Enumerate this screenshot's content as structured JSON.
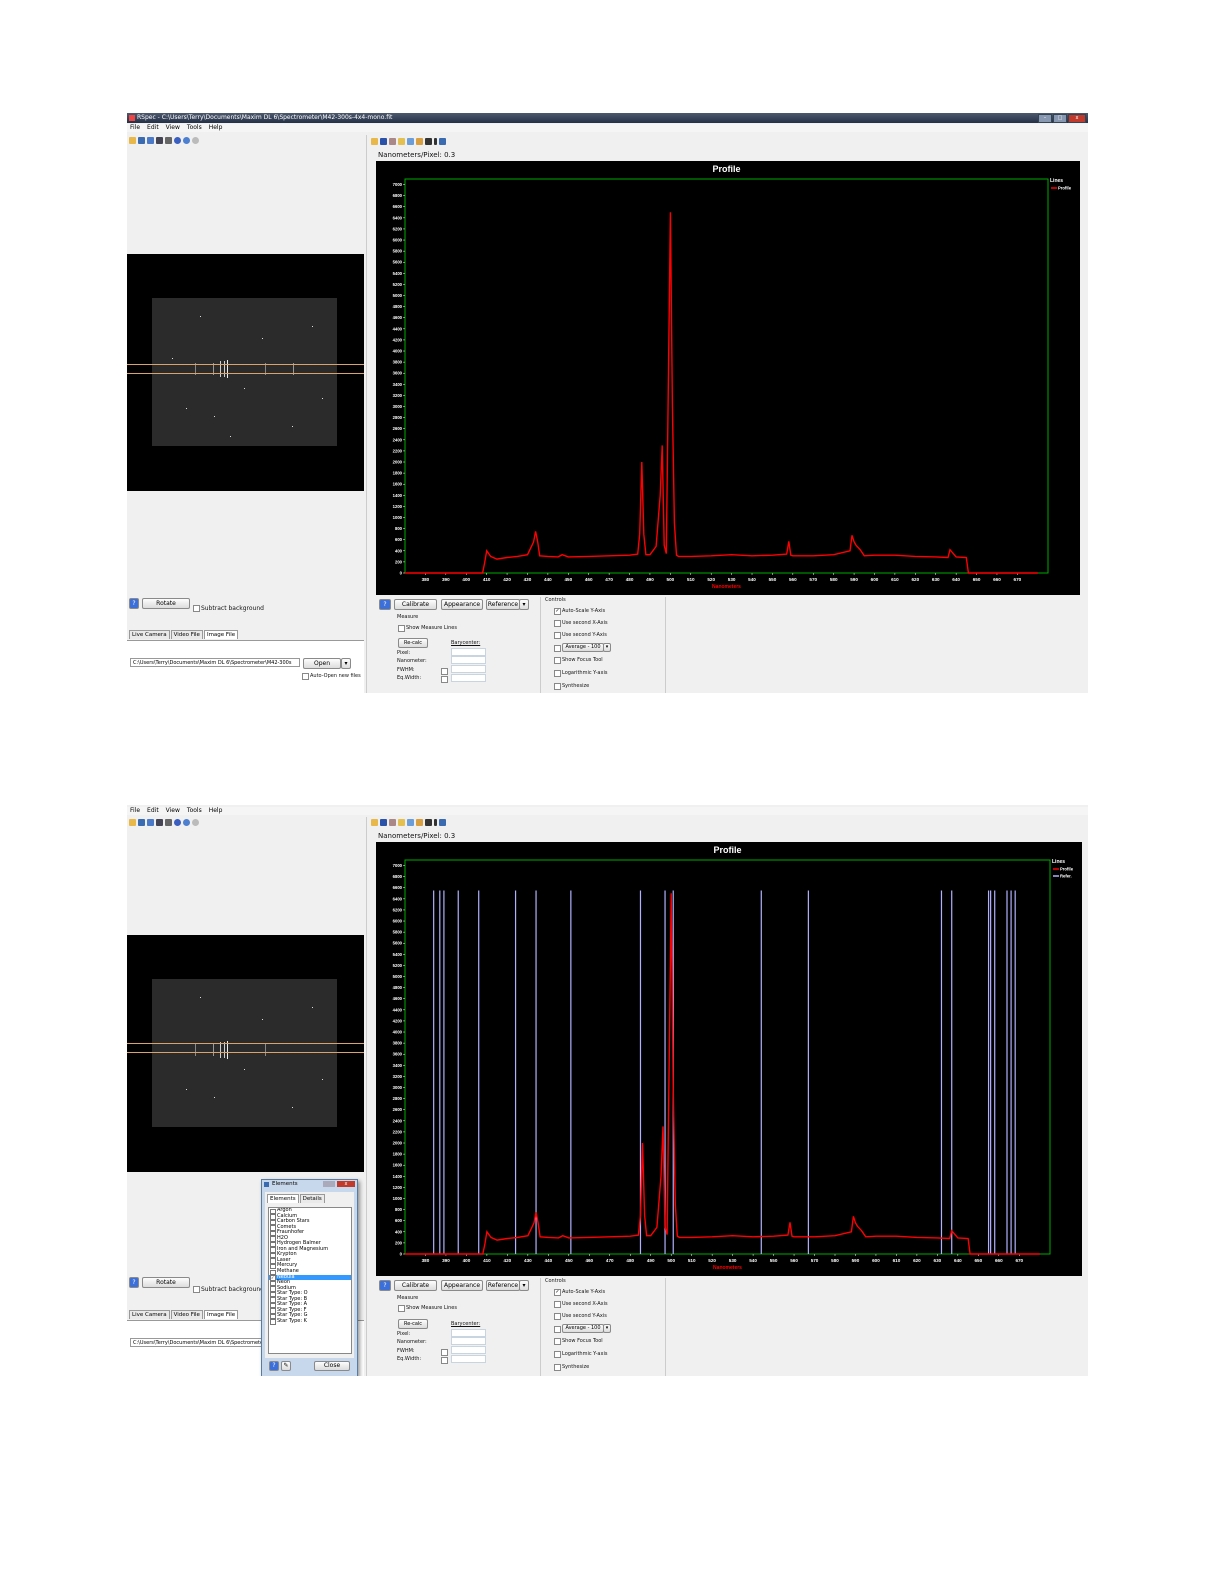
{
  "window": {
    "title": "RSpec - C:\\Users\\Terry\\Documents\\Maxim DL 6\\Spectrometer\\M42-300s-4x4-mono.fit",
    "menu": [
      "File",
      "Edit",
      "View",
      "Tools",
      "Help"
    ]
  },
  "left": {
    "rotate_label": "Rotate",
    "subtract_bg_label": "Subtract background",
    "tabs": [
      "Live Camera",
      "Video File",
      "Image File"
    ],
    "active_tab": "Image File",
    "file_path": "C:\\Users\\Terry\\Documents\\Maxim DL 6\\Spectrometer\\M42-300s",
    "file_path_2": "C:\\Users\\Terry\\Documents\\Maxim DL 6\\Spectromete",
    "open_label": "Open",
    "auto_open_label": "Auto-Open new files"
  },
  "right": {
    "nm_per_pixel": "Nanometers/Pixel: 0.3",
    "calibrate": "Calibrate",
    "appearance": "Appearance",
    "reference": "Reference",
    "measure_label": "Measure",
    "show_measure_lines": "Show Measure Lines",
    "recalc": "Re-calc",
    "barycenter": "Barycenter:",
    "pixel": "Pixel:",
    "nanometer": "Nanometer:",
    "fwhm": "FWHM:",
    "eqwidth": "Eq.Width:",
    "controls_label": "Controls",
    "controls": {
      "auto_scale": "Auto-Scale Y-Axis",
      "second_x": "Use second X-Axis",
      "second_y": "Use second Y-Axis",
      "average": "Average - 100",
      "focus": "Show Focus Tool",
      "log": "Logarithmic Y-axis",
      "synth": "Synthesize"
    }
  },
  "dialog": {
    "title": "Elements",
    "tabs": [
      "Elements",
      "Details"
    ],
    "items": [
      "Argon",
      "Calcium",
      "Carbon Stars",
      "Comets",
      "Fraunhofer",
      "H2O",
      "Hydrogen Balmer",
      "Iron and Magnesium",
      "Krypton",
      "Laser",
      "Mercury",
      "Methane",
      "Nebula",
      "Neon",
      "Sodium",
      "Star Type: O",
      "Star Type: B",
      "Star Type: A",
      "Star Type: F",
      "Star Type: G",
      "Star Type: K"
    ],
    "selected": "Nebula",
    "close_label": "Close"
  },
  "colors": {
    "profile": "#ff0000",
    "reference": "#b0b0ff",
    "frame": "#00aa00",
    "chart_bg": "#000000"
  },
  "chart_data": [
    {
      "type": "line",
      "title": "Profile",
      "xlabel": "Nanometers",
      "ylabel": "",
      "xlim": [
        370,
        685
      ],
      "ylim": [
        0,
        7100
      ],
      "x_ticks": [
        380,
        390,
        400,
        410,
        420,
        430,
        440,
        450,
        460,
        470,
        480,
        490,
        500,
        510,
        520,
        530,
        540,
        550,
        560,
        570,
        580,
        590,
        600,
        610,
        620,
        630,
        640,
        650,
        660,
        670
      ],
      "y_ticks": [
        0,
        200,
        400,
        600,
        800,
        1000,
        1200,
        1400,
        1600,
        1800,
        2000,
        2200,
        2400,
        2600,
        2800,
        3000,
        3200,
        3400,
        3600,
        3800,
        4000,
        4200,
        4400,
        4600,
        4800,
        5000,
        5200,
        5400,
        5600,
        5800,
        6000,
        6200,
        6400,
        6600,
        6800,
        7000
      ],
      "legend_title": "Lines",
      "legend_position": "top-right",
      "series": [
        {
          "name": "Profile",
          "x": [
            370,
            408,
            409,
            410,
            412,
            415,
            420,
            425,
            430,
            433,
            434,
            435,
            436,
            440,
            445,
            447,
            450,
            460,
            470,
            480,
            484,
            485,
            486,
            487,
            488,
            490,
            493,
            495,
            496,
            497,
            498,
            500,
            501,
            502,
            503,
            504,
            510,
            520,
            530,
            540,
            550,
            557,
            558,
            559,
            560,
            570,
            580,
            588,
            589,
            590,
            591,
            593,
            595,
            600,
            610,
            620,
            630,
            636,
            637,
            640,
            645,
            646,
            680
          ],
          "y": [
            0,
            0,
            180,
            400,
            300,
            250,
            280,
            300,
            330,
            560,
            750,
            560,
            310,
            300,
            290,
            330,
            290,
            300,
            310,
            320,
            340,
            700,
            2000,
            700,
            330,
            330,
            480,
            1400,
            2300,
            500,
            350,
            6500,
            3000,
            900,
            320,
            300,
            300,
            310,
            330,
            310,
            320,
            340,
            570,
            320,
            310,
            310,
            330,
            400,
            680,
            560,
            500,
            420,
            310,
            320,
            320,
            300,
            290,
            280,
            420,
            290,
            280,
            0,
            0
          ]
        }
      ]
    },
    {
      "type": "line",
      "title": "Profile",
      "xlabel": "Nanometers",
      "ylabel": "",
      "xlim": [
        370,
        685
      ],
      "ylim": [
        0,
        7100
      ],
      "x_ticks": [
        380,
        390,
        400,
        410,
        420,
        430,
        440,
        450,
        460,
        470,
        480,
        490,
        500,
        510,
        520,
        530,
        540,
        550,
        560,
        570,
        580,
        590,
        600,
        610,
        620,
        630,
        640,
        650,
        660,
        670
      ],
      "y_ticks": [
        0,
        200,
        400,
        600,
        800,
        1000,
        1200,
        1400,
        1600,
        1800,
        2000,
        2200,
        2400,
        2600,
        2800,
        3000,
        3200,
        3400,
        3600,
        3800,
        4000,
        4200,
        4400,
        4600,
        4800,
        5000,
        5200,
        5400,
        5600,
        5800,
        6000,
        6200,
        6400,
        6600,
        6800,
        7000
      ],
      "legend_title": "Lines",
      "legend_position": "top-right",
      "series": [
        {
          "name": "Profile",
          "x": [
            370,
            408,
            409,
            410,
            412,
            415,
            420,
            425,
            430,
            433,
            434,
            435,
            436,
            440,
            445,
            447,
            450,
            460,
            470,
            480,
            484,
            485,
            486,
            487,
            488,
            490,
            493,
            495,
            496,
            497,
            498,
            500,
            501,
            502,
            503,
            504,
            510,
            520,
            530,
            540,
            550,
            557,
            558,
            559,
            560,
            570,
            580,
            588,
            589,
            590,
            591,
            593,
            595,
            600,
            610,
            620,
            630,
            636,
            637,
            640,
            645,
            646,
            680
          ],
          "y": [
            0,
            0,
            180,
            400,
            300,
            250,
            280,
            300,
            330,
            560,
            750,
            560,
            310,
            300,
            290,
            330,
            290,
            300,
            310,
            320,
            340,
            700,
            2000,
            700,
            330,
            330,
            480,
            1400,
            2300,
            500,
            350,
            6500,
            3000,
            900,
            320,
            300,
            300,
            310,
            330,
            310,
            320,
            340,
            570,
            320,
            310,
            310,
            330,
            400,
            680,
            560,
            500,
            420,
            310,
            320,
            320,
            300,
            290,
            280,
            420,
            290,
            280,
            0,
            0
          ]
        },
        {
          "name": "Refer.",
          "lines_x": [
            384,
            387,
            389,
            396,
            406,
            424,
            434,
            451,
            485,
            497,
            501,
            544,
            567,
            632,
            637,
            655,
            656,
            658,
            664,
            666,
            668
          ],
          "height": 6550
        }
      ]
    }
  ]
}
